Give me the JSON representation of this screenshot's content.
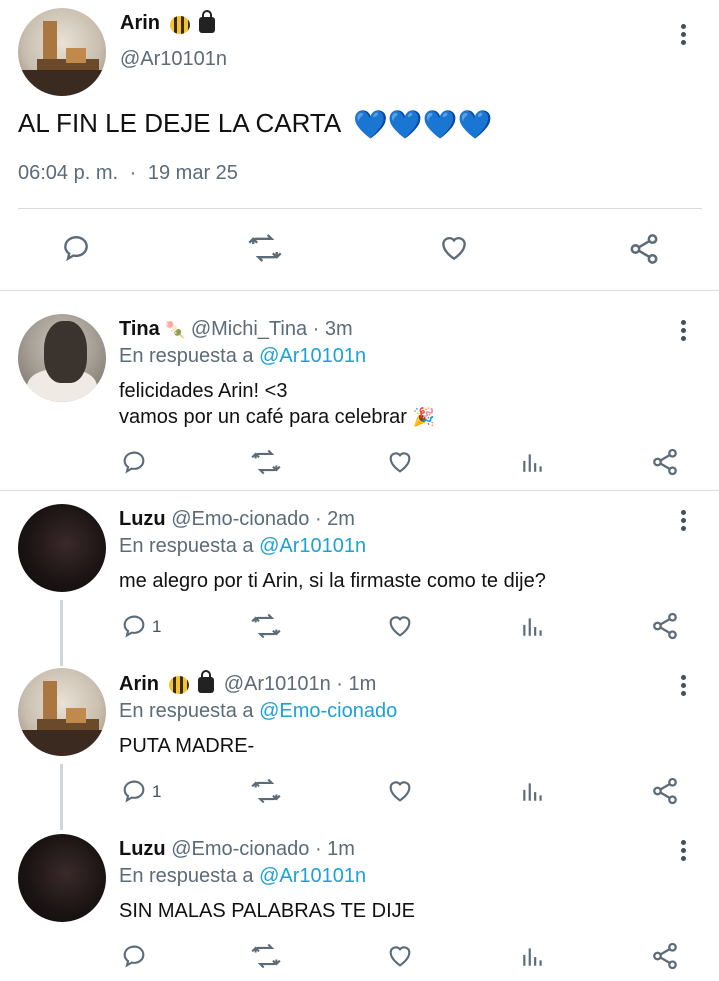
{
  "main_tweet": {
    "name": "Arin",
    "handle": "@Ar10101n",
    "text": "AL FIN LE DEJE LA CARTA",
    "hearts": "💙💙💙💙",
    "time": "06:04 p. m.",
    "separator": "·",
    "date": "19 mar 25"
  },
  "replies": [
    {
      "name": "Tina",
      "emoji": "🍡",
      "handle": "@Michi_Tina",
      "time": "3m",
      "reply_prefix": "En respuesta a",
      "reply_to": "@Ar10101n",
      "line1": "felicidades Arin! <3",
      "line2": "vamos por un café para celebrar",
      "line2_emoji": "🎉",
      "reply_count": ""
    },
    {
      "name": "Luzu",
      "handle": "@Emo-cionado",
      "time": "2m",
      "reply_prefix": "En respuesta a",
      "reply_to": "@Ar10101n",
      "line1": "me alegro por ti Arin, si la firmaste como te dije?",
      "reply_count": "1"
    },
    {
      "name": "Arin",
      "handle": "@Ar10101n",
      "time": "1m",
      "reply_prefix": "En respuesta a",
      "reply_to": "@Emo-cionado",
      "line1": "PUTA MADRE-",
      "reply_count": "1"
    },
    {
      "name": "Luzu",
      "handle": "@Emo-cionado",
      "time": "1m",
      "reply_prefix": "En respuesta a",
      "reply_to": "@Ar10101n",
      "line1": "SIN MALAS PALABRAS TE DIJE",
      "reply_count": ""
    }
  ],
  "colors": {
    "link": "#1da1d6",
    "muted": "#5b6b78",
    "heart": "#5fc1ee",
    "icon": "#5b6b78"
  },
  "icons": {
    "reply": "comment-icon",
    "retweet": "retweet-icon",
    "like": "heart-icon",
    "stats": "stats-icon",
    "share": "share-icon",
    "more": "more-vertical-icon"
  }
}
